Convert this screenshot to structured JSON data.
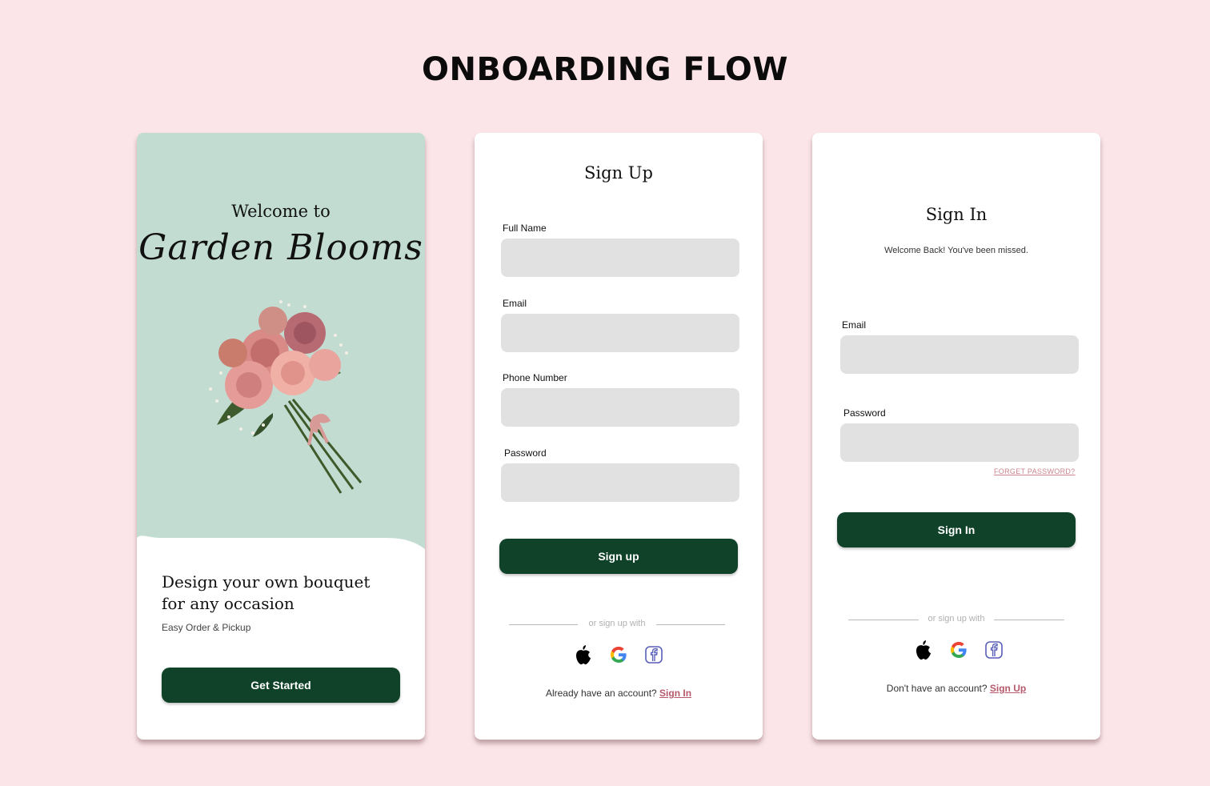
{
  "page": {
    "title": "ONBOARDING FLOW"
  },
  "welcome": {
    "welcome_to": "Welcome to",
    "brand": "Garden Blooms",
    "headline_line1": "Design your own bouquet",
    "headline_line2": "for any occasion",
    "subline": "Easy Order & Pickup",
    "cta": "Get Started",
    "hero_color": "#c2dcd2"
  },
  "signup": {
    "title": "Sign Up",
    "fields": [
      {
        "label": "Full Name",
        "value": ""
      },
      {
        "label": "Email",
        "value": ""
      },
      {
        "label": "Phone Number",
        "value": ""
      },
      {
        "label": "Password",
        "value": ""
      }
    ],
    "submit": "Sign up",
    "divider": "or sign up with",
    "social": [
      "apple-icon",
      "google-icon",
      "facebook-icon"
    ],
    "switch_prompt": "Already have an account?",
    "switch_link": "Sign In"
  },
  "signin": {
    "title": "Sign In",
    "subtitle": "Welcome Back! You've been missed.",
    "fields": [
      {
        "label": "Email",
        "value": ""
      },
      {
        "label": "Password",
        "value": ""
      }
    ],
    "forgot": "FORGET PASSWORD?",
    "submit": "Sign In",
    "divider": "or sign up with",
    "social": [
      "apple-icon",
      "google-icon",
      "facebook-icon"
    ],
    "switch_prompt": "Don't have an account?",
    "switch_link": "Sign Up"
  },
  "colors": {
    "background": "#fbe5e8",
    "primary_button": "#0f4228",
    "link": "#b5596a",
    "input": "#e1e1e1",
    "hero": "#c2dcd2"
  }
}
